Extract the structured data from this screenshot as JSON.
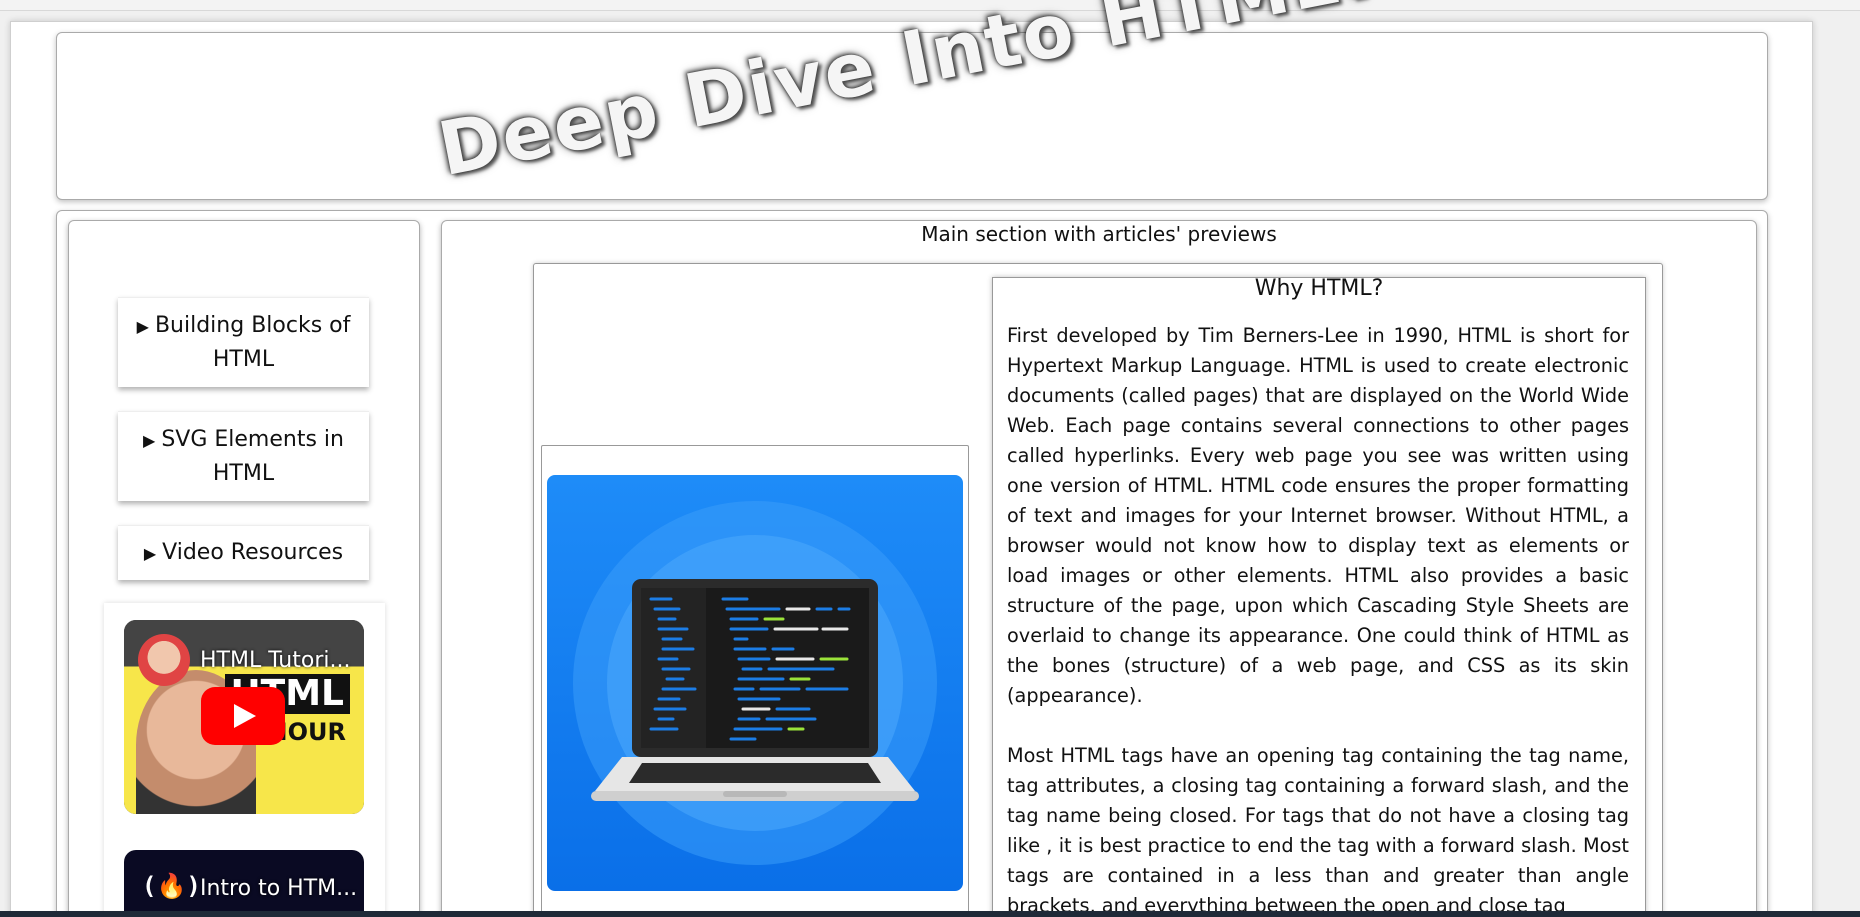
{
  "header": {
    "title": "Deep Dive Into HTML!"
  },
  "sidebar": {
    "items": [
      {
        "label": "Building Blocks of HTML"
      },
      {
        "label": "SVG Elements in HTML"
      },
      {
        "label": "Video Resources"
      }
    ],
    "videos": [
      {
        "title": "HTML Tutori...",
        "thumbnail_text": "HTML",
        "thumbnail_subtext": "HOUR"
      },
      {
        "title": "Intro to HTM..."
      }
    ]
  },
  "main": {
    "caption": "Main section with articles' previews",
    "article": {
      "title": "Why HTML?",
      "paragraphs": [
        "First developed by Tim Berners-Lee in 1990, HTML is short for Hypertext Markup Language. HTML is used to create electronic documents (called pages) that are displayed on the World Wide Web. Each page contains several connections to other pages called hyperlinks. Every web page you see was written using one version of HTML. HTML code ensures the proper formatting of text and images for your Internet browser. Without HTML, a browser would not know how to display text as elements or load images or other elements. HTML also provides a basic structure of the page, upon which Cascading Style Sheets are overlaid to change its appearance. One could think of HTML as the bones (structure) of a web page, and CSS as its skin (appearance).",
        "Most HTML tags have an opening tag containing the tag name, tag attributes, a closing tag containing a forward slash, and the tag name being closed. For tags that do not have a closing tag like , it is best practice to end the tag with a forward slash. Most tags are contained in a less than and greater than angle brackets, and everything between the open and close tag"
      ]
    }
  },
  "colors": {
    "illustration_blue": "#1e8cf8",
    "youtube_red": "#ff0000",
    "bottom_bar": "#1f2a38"
  }
}
